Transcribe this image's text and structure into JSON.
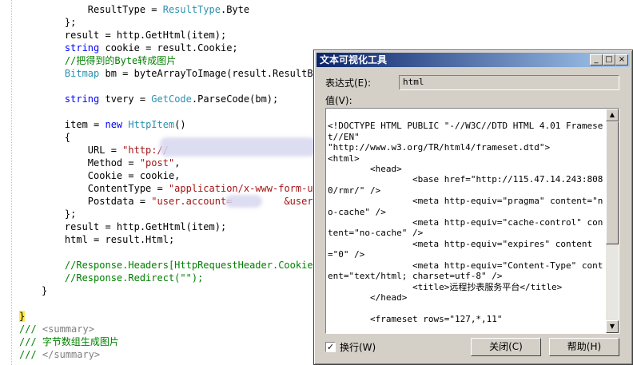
{
  "editor": {
    "lines": [
      {
        "t": "plain",
        "parts": [
          {
            "c": "        ResultType = "
          },
          {
            "c": "ResultType",
            "k": "ty"
          },
          {
            "c": ".Byte"
          }
        ]
      },
      {
        "t": "plain",
        "parts": [
          {
            "c": "    };"
          }
        ]
      },
      {
        "t": "plain",
        "parts": [
          {
            "c": "    result = http.GetHtml(item);"
          }
        ]
      },
      {
        "t": "plain",
        "parts": [
          {
            "c": "    "
          },
          {
            "c": "string",
            "k": "kw"
          },
          {
            "c": " cookie = result.Cookie;"
          }
        ]
      },
      {
        "t": "plain",
        "parts": [
          {
            "c": "    //把得到的Byte转成图片",
            "k": "cm"
          }
        ]
      },
      {
        "t": "plain",
        "parts": [
          {
            "c": "    "
          },
          {
            "c": "Bitmap",
            "k": "ty"
          },
          {
            "c": " bm = byteArrayToImage(result.ResultByt"
          }
        ]
      },
      {
        "t": "plain",
        "parts": [
          {
            "c": ""
          }
        ]
      },
      {
        "t": "plain",
        "parts": [
          {
            "c": "    "
          },
          {
            "c": "string",
            "k": "kw"
          },
          {
            "c": " tvery = "
          },
          {
            "c": "GetCode",
            "k": "ty"
          },
          {
            "c": ".ParseCode(bm);"
          }
        ]
      },
      {
        "t": "plain",
        "parts": [
          {
            "c": ""
          }
        ]
      },
      {
        "t": "plain",
        "parts": [
          {
            "c": "    item = "
          },
          {
            "c": "new",
            "k": "kw"
          },
          {
            "c": " "
          },
          {
            "c": "HttpItem",
            "k": "ty"
          },
          {
            "c": "()"
          }
        ]
      },
      {
        "t": "plain",
        "parts": [
          {
            "c": "    {"
          }
        ]
      },
      {
        "t": "plain",
        "parts": [
          {
            "c": "        URL = "
          },
          {
            "c": "\"http://",
            "k": "str"
          }
        ]
      },
      {
        "t": "plain",
        "parts": [
          {
            "c": "        Method = "
          },
          {
            "c": "\"post\"",
            "k": "str"
          },
          {
            "c": ","
          }
        ]
      },
      {
        "t": "plain",
        "parts": [
          {
            "c": "        Cookie = cookie,"
          }
        ]
      },
      {
        "t": "plain",
        "parts": [
          {
            "c": "        ContentType = "
          },
          {
            "c": "\"application/x-www-form-url",
            "k": "str"
          }
        ]
      },
      {
        "t": "plain",
        "parts": [
          {
            "c": "        Postdata = "
          },
          {
            "c": "\"user.account=         &user.pas",
            "k": "str"
          }
        ]
      },
      {
        "t": "plain",
        "parts": [
          {
            "c": "    };"
          }
        ]
      },
      {
        "t": "plain",
        "parts": [
          {
            "c": "    result = http.GetHtml(item);"
          }
        ]
      },
      {
        "t": "plain",
        "parts": [
          {
            "c": "    html = result.Html;"
          }
        ]
      },
      {
        "t": "plain",
        "parts": [
          {
            "c": ""
          }
        ]
      },
      {
        "t": "plain",
        "parts": [
          {
            "c": "    //Response.Headers[HttpRequestHeader.Cookie]",
            "k": "cm"
          }
        ]
      },
      {
        "t": "plain",
        "parts": [
          {
            "c": "    //Response.Redirect(\"\");",
            "k": "cm"
          }
        ]
      },
      {
        "t": "plain",
        "parts": [
          {
            "c": "}"
          }
        ]
      },
      {
        "t": "plain",
        "parts": [
          {
            "c": ""
          }
        ]
      },
      {
        "t": "brace",
        "parts": [
          {
            "c": "}",
            "k": "hl"
          }
        ]
      },
      {
        "t": "plain",
        "parts": [
          {
            "c": "/// ",
            "k": "cm"
          },
          {
            "c": "<summary>",
            "k": "xd"
          }
        ]
      },
      {
        "t": "plain",
        "parts": [
          {
            "c": "/// 字节数组生成图片",
            "k": "cm"
          }
        ]
      },
      {
        "t": "plain",
        "parts": [
          {
            "c": "/// ",
            "k": "cm"
          },
          {
            "c": "</summary>",
            "k": "xd"
          }
        ]
      }
    ]
  },
  "dialog": {
    "title": "文本可视化工具",
    "minimize_glyph": "_",
    "maximize_glyph": "□",
    "close_glyph": "×",
    "expression_label": "表达式(E):",
    "expression_value": "html",
    "value_label": "值(V):",
    "value_text": "\n<!DOCTYPE HTML PUBLIC \"-//W3C//DTD HTML 4.01 Frameset//EN\"\n\"http://www.w3.org/TR/html4/frameset.dtd\">\n<html>\n        <head>\n                <base href=\"http://115.47.14.243:8080/rmr/\" />\n                <meta http-equiv=\"pragma\" content=\"no-cache\" />\n                <meta http-equiv=\"cache-control\" content=\"no-cache\" />\n                <meta http-equiv=\"expires\" content=\"0\" />\n                <meta http-equiv=\"Content-Type\" content=\"text/html; charset=utf-8\" />\n                <title>远程抄表服务平台</title>\n        </head>\n\n        <frameset rows=\"127,*,11\"",
    "wrap_label": "换行(W)",
    "wrap_checked": "✓",
    "close_button": "关闭(C)",
    "help_button": "帮助(H)",
    "scroll_up": "▲",
    "scroll_down": "▼"
  }
}
